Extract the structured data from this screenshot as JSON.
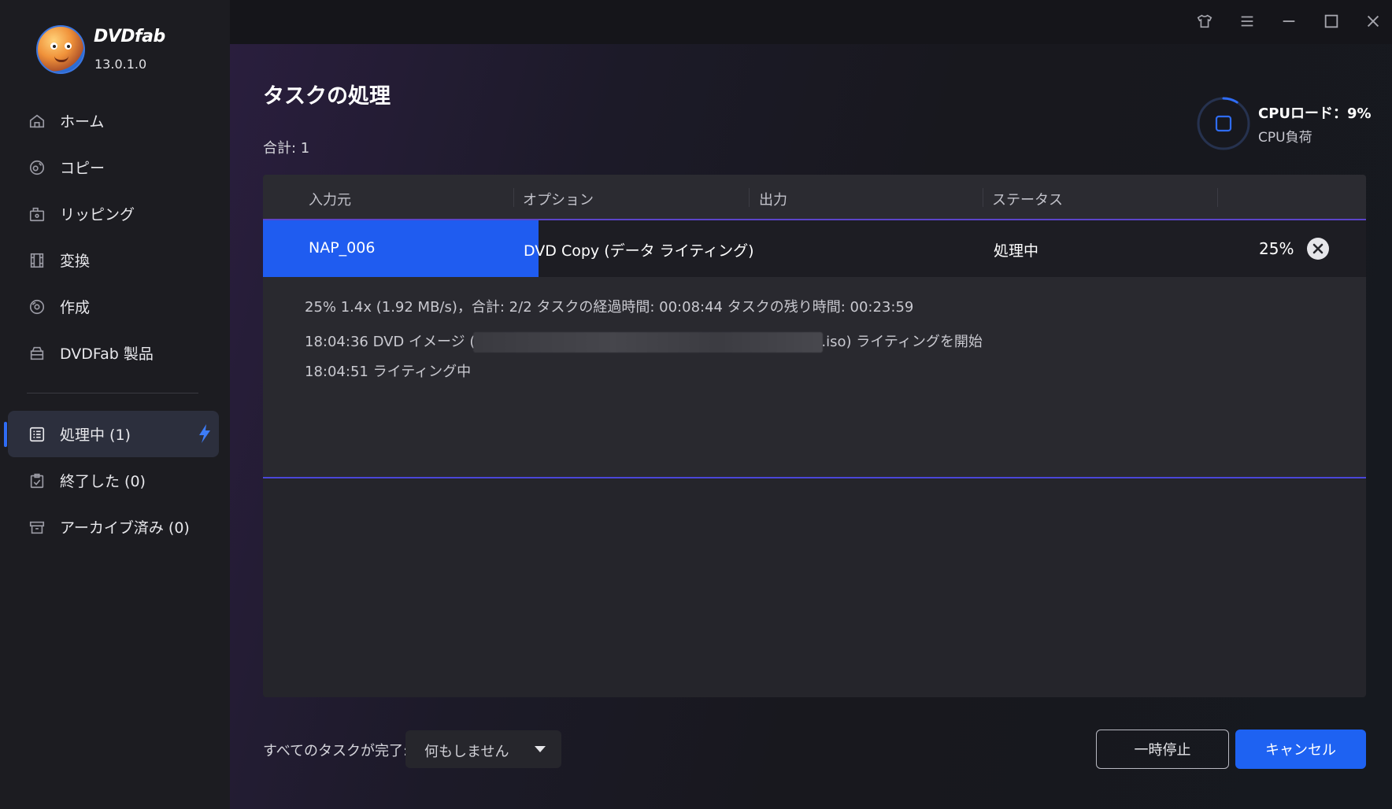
{
  "app": {
    "name": "DVDfab",
    "version": "13.0.1.0"
  },
  "sidebar": {
    "items": [
      {
        "label": "ホーム",
        "icon": "home-icon"
      },
      {
        "label": "コピー",
        "icon": "copy-icon"
      },
      {
        "label": "リッピング",
        "icon": "ripping-icon"
      },
      {
        "label": "変換",
        "icon": "film-icon"
      },
      {
        "label": "作成",
        "icon": "disc-icon"
      },
      {
        "label": "DVDFab 製品",
        "icon": "products-icon"
      }
    ],
    "queue": [
      {
        "label": "処理中 (1)",
        "icon": "list-icon",
        "active": true
      },
      {
        "label": "終了した (0)",
        "icon": "clipboard-icon"
      },
      {
        "label": "アーカイブ済み (0)",
        "icon": "archive-icon"
      }
    ]
  },
  "titlebar": {
    "icons": [
      "skin-icon",
      "menu-icon",
      "minimize-icon",
      "maximize-icon",
      "close-icon"
    ]
  },
  "main": {
    "title": "タスクの処理",
    "total": "合計: 1",
    "cpu": {
      "label": "CPUロード：9%",
      "sub": "CPU負荷",
      "load": 0.09
    },
    "table": {
      "headers": [
        "入力元",
        "オプション",
        "出力",
        "ステータス"
      ],
      "task": {
        "source": "NAP_006",
        "option": "DVD Copy (データ ライティング)",
        "output": "",
        "status": "処理中",
        "percent": "25%",
        "progress": 0.25
      },
      "details": {
        "stats": "25%  1.4x (1.92 MB/s)，合計: 2/2  タスクの経過時間: 00:08:44  タスクの残り時間: 00:23:59",
        "log": [
          {
            "time": "18:04:36",
            "prefix": "DVD イメージ (",
            "suffix": ".iso) ライティングを開始"
          },
          {
            "time": "18:04:51",
            "prefix": "ライティング中",
            "suffix": ""
          }
        ]
      }
    }
  },
  "footer": {
    "when_done_label": "すべてのタスクが完了:",
    "when_done_value": "何もしません",
    "pause_label": "一時停止",
    "cancel_label": "キャンセル"
  },
  "colors": {
    "accent": "#1e62f2",
    "sidebar_bg": "#1c1c21",
    "progress": "#1f5cf0"
  }
}
